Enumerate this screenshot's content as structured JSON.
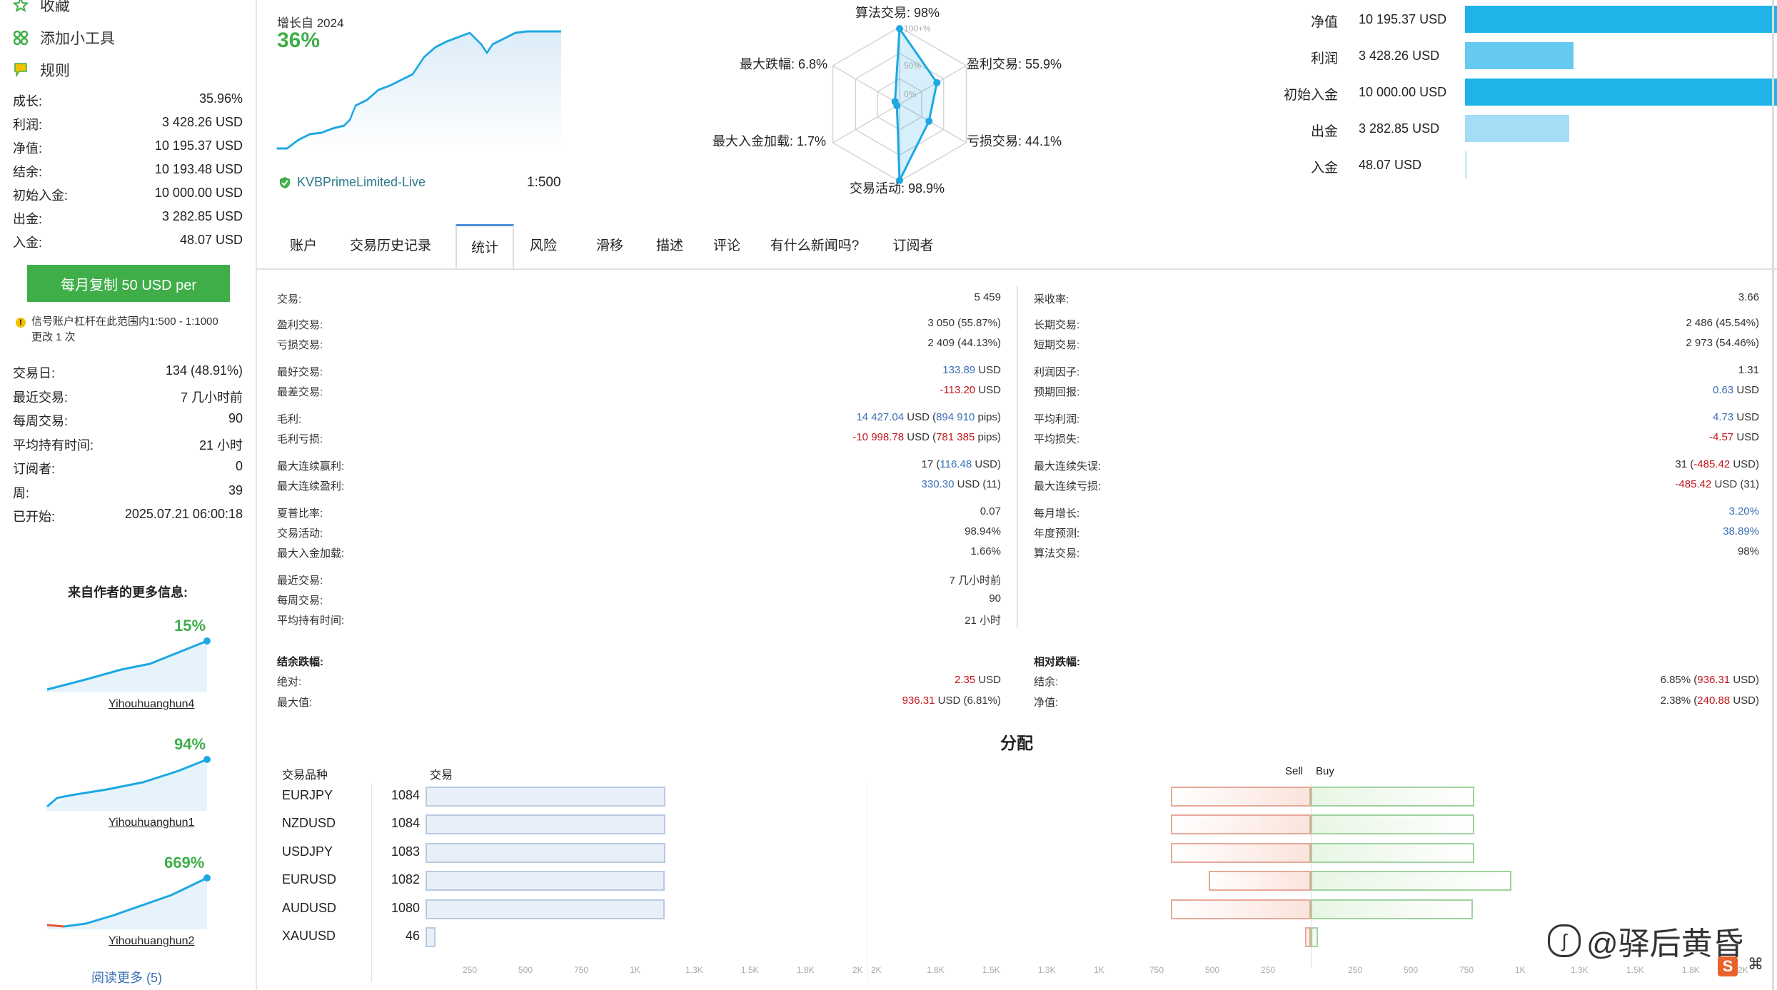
{
  "sidebar": {
    "menu": [
      {
        "label": "收藏",
        "icon": "star-icon"
      },
      {
        "label": "添加小工具",
        "icon": "widgets-icon"
      },
      {
        "label": "规则",
        "icon": "rules-flag-icon"
      }
    ],
    "summary": [
      {
        "k": "成长:",
        "v": "35.96%"
      },
      {
        "k": "利润:",
        "v": "3 428.26 USD"
      },
      {
        "k": "净值:",
        "v": "10 195.37 USD"
      },
      {
        "k": "结余:",
        "v": "10 193.48 USD"
      },
      {
        "k": "初始入金:",
        "v": "10 000.00 USD"
      },
      {
        "k": "出金:",
        "v": "3 282.85 USD"
      },
      {
        "k": "入金:",
        "v": "48.07 USD"
      }
    ],
    "copy_button": "每月复制 50 USD per",
    "leverage_note_1": "信号账户杠杆在此范围内1:500 - 1:1000",
    "leverage_note_2": "更改 1 次",
    "activity": [
      {
        "k": "交易日:",
        "v": "134 (48.91%)"
      },
      {
        "k": "最近交易:",
        "v": "7 几小时前"
      },
      {
        "k": "每周交易:",
        "v": "90"
      },
      {
        "k": "平均持有时间:",
        "v": "21 小时"
      },
      {
        "k": "订阅者:",
        "v": "0"
      },
      {
        "k": "周:",
        "v": "39"
      },
      {
        "k": "已开始:",
        "v": "2025.07.21 06:00:18"
      }
    ],
    "more_title": "来自作者的更多信息:",
    "signals": [
      {
        "pct": "15%",
        "name": "Yihouhuanghun4"
      },
      {
        "pct": "94%",
        "name": "Yihouhuanghun1"
      },
      {
        "pct": "669%",
        "name": "Yihouhuanghun2"
      }
    ],
    "read_more": "阅读更多 (5)"
  },
  "header": {
    "growth_since": "增长自 2024",
    "growth_value": "36%",
    "broker": "KVBPrimeLimited-Live",
    "leverage": "1:500",
    "radar": {
      "algo": "算法交易: 98%",
      "profit_trades": "盈利交易: 55.9%",
      "loss_trades": "亏损交易: 44.1%",
      "activity": "交易活动: 98.9%",
      "max_deposit_load": "最大入金加载: 1.7%",
      "max_drawdown": "最大跌幅: 6.8%",
      "ticks": [
        "100+%",
        "50%",
        "0%"
      ],
      "values": [
        98,
        55.9,
        44.1,
        98.9,
        1.7,
        6.8
      ]
    },
    "bars": [
      {
        "label": "净值",
        "value": "10 195.37 USD",
        "amount": 10195.37,
        "color": "#1fb3e8"
      },
      {
        "label": "利润",
        "value": "3 428.26 USD",
        "amount": 3428.26,
        "color": "#66c9f0"
      },
      {
        "label": "初始入金",
        "value": "10 000.00 USD",
        "amount": 10000.0,
        "color": "#1fb3e8"
      },
      {
        "label": "出金",
        "value": "3 282.85 USD",
        "amount": 3282.85,
        "color": "#a6ddf6"
      },
      {
        "label": "入金",
        "value": "48.07 USD",
        "amount": 48.07,
        "color": "#cdeefb"
      }
    ]
  },
  "tabs": [
    "账户",
    "交易历史记录",
    "统计",
    "风险",
    "滑移",
    "描述",
    "评论",
    "有什么新闻吗?",
    "订阅者"
  ],
  "active_tab": "统计",
  "stats_left": [
    {
      "k": "交易:",
      "v": "5 459"
    },
    {
      "k": "盈利交易:",
      "v": "3 050 (55.87%)"
    },
    {
      "k": "亏损交易:",
      "v": "2 409 (44.13%)"
    },
    {
      "k": "最好交易:",
      "v": "133.89",
      "u": " USD",
      "c": "blue"
    },
    {
      "k": "最差交易:",
      "v": "-113.20",
      "u": " USD",
      "c": "red"
    },
    {
      "k": "毛利:",
      "v": "14 427.04",
      "u": " USD (",
      "v2": "894 910",
      "u2": " pips)",
      "c": "blue"
    },
    {
      "k": "毛利亏损:",
      "v": "-10 998.78",
      "u": " USD (",
      "v2": "781 385",
      "u2": " pips)",
      "c": "red"
    },
    {
      "k": "最大连续赢利:",
      "v": "17 (",
      "v2": "116.48",
      "u2": " USD)",
      "c": "blue",
      "pre": true
    },
    {
      "k": "最大连续盈利:",
      "v": "330.30",
      "u": " USD (11)",
      "c": "blue"
    },
    {
      "k": "夏普比率:",
      "v": "0.07"
    },
    {
      "k": "交易活动:",
      "v": "98.94%"
    },
    {
      "k": "最大入金加载:",
      "v": "1.66%"
    },
    {
      "k": "最近交易:",
      "v": "7 几小时前"
    },
    {
      "k": "每周交易:",
      "v": "90"
    },
    {
      "k": "平均持有时间:",
      "v": "21 小时"
    }
  ],
  "stats_right": [
    {
      "k": "采收率:",
      "v": "3.66"
    },
    {
      "k": "长期交易:",
      "v": "2 486 (45.54%)"
    },
    {
      "k": "短期交易:",
      "v": "2 973 (54.46%)"
    },
    {
      "k": "利润因子:",
      "v": "1.31"
    },
    {
      "k": "预期回报:",
      "v": "0.63",
      "u": " USD",
      "c": "blue"
    },
    {
      "k": "平均利润:",
      "v": "4.73",
      "u": " USD",
      "c": "blue"
    },
    {
      "k": "平均损失:",
      "v": "-4.57",
      "u": " USD",
      "c": "red"
    },
    {
      "k": "最大连续失误:",
      "v": "31 (",
      "v2": "-485.42",
      "u2": " USD)",
      "c": "red",
      "pre": true
    },
    {
      "k": "最大连续亏损:",
      "v": "-485.42",
      "u": " USD (31)",
      "c": "red"
    },
    {
      "k": "每月增长:",
      "v": "3.20%",
      "c": "blue"
    },
    {
      "k": "年度预测:",
      "v": "38.89%",
      "c": "blue"
    },
    {
      "k": "算法交易:",
      "v": "98%"
    }
  ],
  "balance_dd": {
    "title": "结余跌幅:",
    "rows": [
      {
        "k": "绝对:",
        "v": "2.35",
        "u": " USD",
        "c": "red"
      },
      {
        "k": "最大值:",
        "v": "936.31",
        "u": " USD (6.81%)",
        "c": "red"
      }
    ]
  },
  "relative_dd": {
    "title": "相对跌幅:",
    "rows": [
      {
        "k": "结余:",
        "pre": "6.85% (",
        "v": "936.31",
        "u": " USD)",
        "c": "red"
      },
      {
        "k": "净值:",
        "pre": "2.38% (",
        "v": "240.88",
        "u": " USD)",
        "c": "red"
      }
    ]
  },
  "distribution": {
    "title": "分配",
    "col_symbol": "交易品种",
    "col_trades": "交易",
    "col_sell": "Sell",
    "col_buy": "Buy",
    "rows": [
      {
        "symbol": "EURJPY",
        "count": "1084",
        "trades": 1084,
        "sell": 500,
        "buy": 584
      },
      {
        "symbol": "NZDUSD",
        "count": "1084",
        "trades": 1084,
        "sell": 501,
        "buy": 583
      },
      {
        "symbol": "USDJPY",
        "count": "1083",
        "trades": 1083,
        "sell": 500,
        "buy": 583
      },
      {
        "symbol": "EURUSD",
        "count": "1082",
        "trades": 1082,
        "sell": 365,
        "buy": 717
      },
      {
        "symbol": "AUDUSD",
        "count": "1080",
        "trades": 1080,
        "sell": 500,
        "buy": 580
      },
      {
        "symbol": "XAUUSD",
        "count": "46",
        "trades": 46,
        "sell": 20,
        "buy": 26
      }
    ],
    "axis_trades": [
      "250",
      "500",
      "750",
      "1K",
      "1.3K",
      "1.5K",
      "1.8K",
      "2K"
    ],
    "axis_sell": [
      "2K",
      "1.8K",
      "1.5K",
      "1.3K",
      "1K",
      "750",
      "500",
      "250"
    ],
    "axis_buy": [
      "250",
      "500",
      "750",
      "1K",
      "1.3K",
      "1.5K",
      "1.8K",
      "2K"
    ]
  },
  "watermark": "@驿后黄昏"
}
